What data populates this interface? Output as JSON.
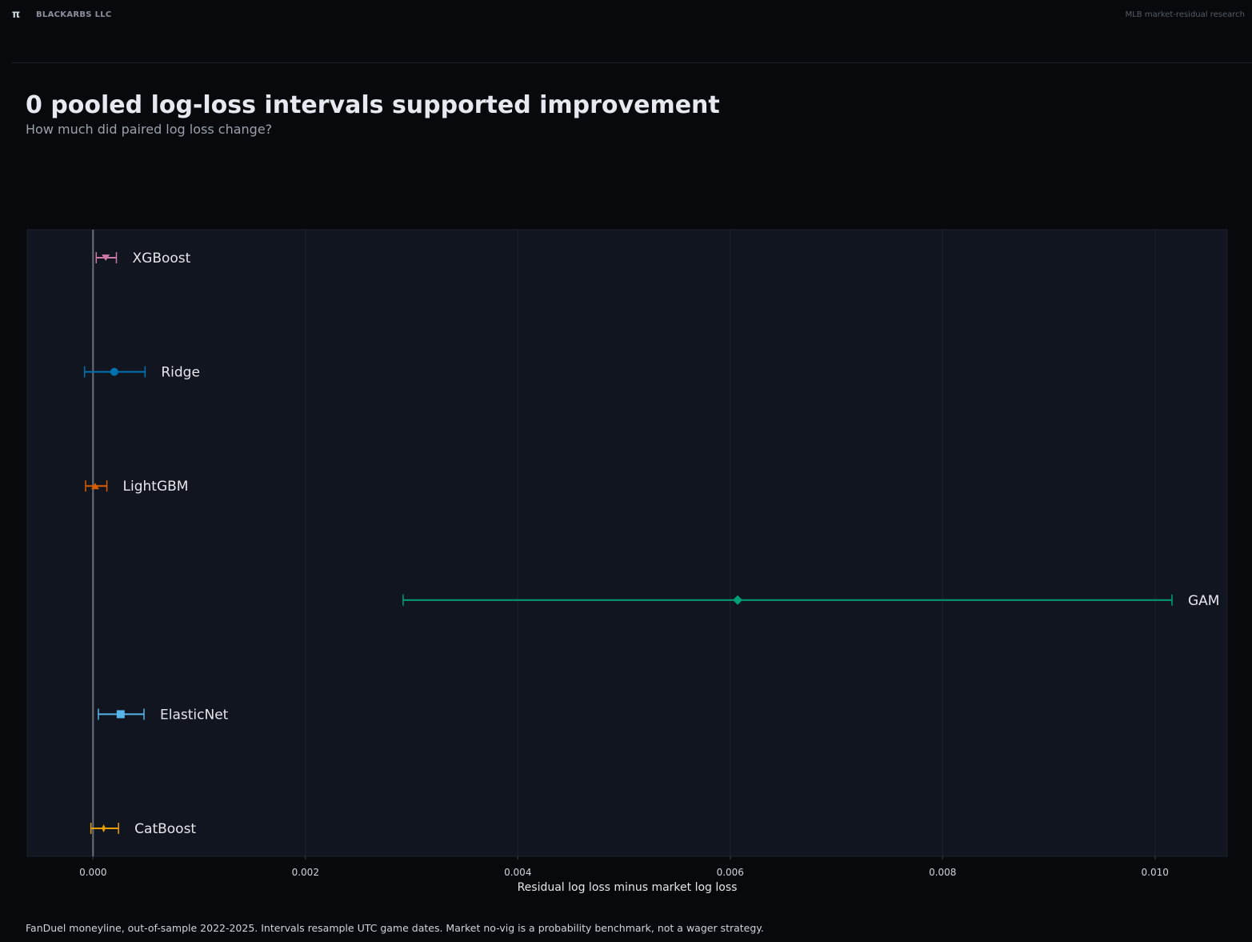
{
  "header": {
    "logo_glyph": "π",
    "brand": "BLACKARBS LLC",
    "tagline": "MLB market-residual research"
  },
  "title": "0 pooled log-loss intervals supported improvement",
  "subtitle": "How much did paired log loss change?",
  "footnote": "FanDuel moneyline, out-of-sample 2022-2025. Intervals resample UTC game dates. Market no-vig is a probability benchmark, not a wager strategy.",
  "colors": {
    "background": "#07090d",
    "plot_background": "#111520",
    "zero_line": "#6b6f76",
    "text": "#e5e7eb"
  },
  "chart_data": {
    "type": "interval",
    "xlabel": "Residual log loss minus market log loss",
    "xlim": [
      -0.00062,
      0.01068
    ],
    "xticks": [
      0.0,
      0.002,
      0.004,
      0.006,
      0.008,
      0.01
    ],
    "xtick_labels": [
      "0.000",
      "0.002",
      "0.004",
      "0.006",
      "0.008",
      "0.010"
    ],
    "reference_line": 0.0,
    "grid": "vertical",
    "series": [
      {
        "name": "XGBoost",
        "estimate": 0.00012,
        "low": 3e-05,
        "high": 0.00022,
        "color": "#cc79a7",
        "marker": "triangle-down"
      },
      {
        "name": "Ridge",
        "estimate": 0.0002,
        "low": -8e-05,
        "high": 0.00049,
        "color": "#0072b2",
        "marker": "circle"
      },
      {
        "name": "LightGBM",
        "estimate": 2e-05,
        "low": -7e-05,
        "high": 0.00013,
        "color": "#d55e00",
        "marker": "triangle-up"
      },
      {
        "name": "GAM",
        "estimate": 0.00607,
        "low": 0.00292,
        "high": 0.01016,
        "color": "#009e73",
        "marker": "diamond"
      },
      {
        "name": "ElasticNet",
        "estimate": 0.00026,
        "low": 5e-05,
        "high": 0.00048,
        "color": "#56b4e9",
        "marker": "square"
      },
      {
        "name": "CatBoost",
        "estimate": 0.0001,
        "low": -2e-05,
        "high": 0.00024,
        "color": "#e69f00",
        "marker": "thin-diamond"
      }
    ]
  }
}
